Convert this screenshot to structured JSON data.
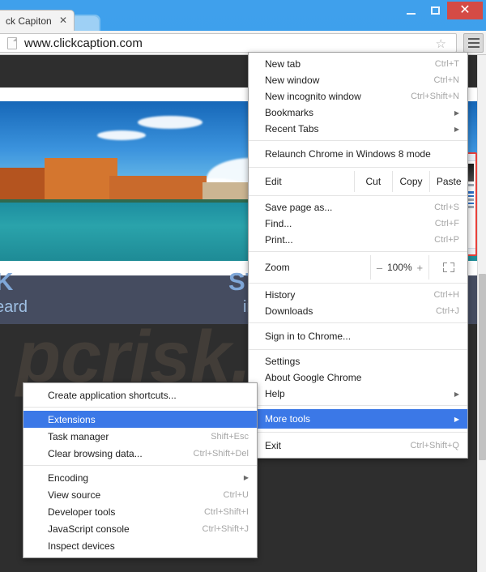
{
  "window": {
    "controls": {
      "minimize": "–",
      "maximize": "□",
      "close": "✕"
    },
    "close_color": "#d44b45",
    "frame_color": "#3fa0ec"
  },
  "tab": {
    "title": "ck Capiton",
    "close": "✕"
  },
  "toolbar": {
    "url": "www.clickcaption.com",
    "star": "☆",
    "menu_button_label": "Chrome menu"
  },
  "page": {
    "promo_heading": "ST STUDY TOOL?",
    "promo_sub": "ing the page you're on!",
    "left_heading_fragment": "K",
    "left_sub_fragment": "eard",
    "watermark": "pcrisk.com"
  },
  "chrome_menu": {
    "items": [
      {
        "label": "New tab",
        "accel": "Ctrl+T"
      },
      {
        "label": "New window",
        "accel": "Ctrl+N"
      },
      {
        "label": "New incognito window",
        "accel": "Ctrl+Shift+N"
      },
      {
        "label": "Bookmarks",
        "arrow": "▶"
      },
      {
        "label": "Recent Tabs",
        "arrow": "▶"
      }
    ],
    "relaunch": {
      "label": "Relaunch Chrome in Windows 8 mode"
    },
    "edit": {
      "label": "Edit",
      "cut": "Cut",
      "copy": "Copy",
      "paste": "Paste"
    },
    "file_items": [
      {
        "label": "Save page as...",
        "accel": "Ctrl+S"
      },
      {
        "label": "Find...",
        "accel": "Ctrl+F"
      },
      {
        "label": "Print...",
        "accel": "Ctrl+P"
      }
    ],
    "zoom": {
      "label": "Zoom",
      "minus": "–",
      "value": "100%",
      "plus": "+"
    },
    "history_items": [
      {
        "label": "History",
        "accel": "Ctrl+H"
      },
      {
        "label": "Downloads",
        "accel": "Ctrl+J"
      }
    ],
    "signin": {
      "label": "Sign in to Chrome..."
    },
    "settings_items": [
      {
        "label": "Settings",
        "accel": ""
      },
      {
        "label": "About Google Chrome",
        "accel": ""
      },
      {
        "label": "Help",
        "arrow": "▶"
      }
    ],
    "more_tools": {
      "label": "More tools",
      "arrow": "▶",
      "highlight_color": "#3b78e7"
    },
    "exit": {
      "label": "Exit",
      "accel": "Ctrl+Shift+Q"
    }
  },
  "sub_menu": {
    "create_shortcuts": {
      "label": "Create application shortcuts...",
      "accel": ""
    },
    "items_group1": [
      {
        "label": "Extensions",
        "accel": "",
        "highlighted": true
      },
      {
        "label": "Task manager",
        "accel": "Shift+Esc"
      },
      {
        "label": "Clear browsing data...",
        "accel": "Ctrl+Shift+Del"
      }
    ],
    "items_group2": [
      {
        "label": "Encoding",
        "arrow": "▶"
      },
      {
        "label": "View source",
        "accel": "Ctrl+U"
      },
      {
        "label": "Developer tools",
        "accel": "Ctrl+Shift+I"
      },
      {
        "label": "JavaScript console",
        "accel": "Ctrl+Shift+J"
      },
      {
        "label": "Inspect devices",
        "accel": ""
      }
    ]
  }
}
